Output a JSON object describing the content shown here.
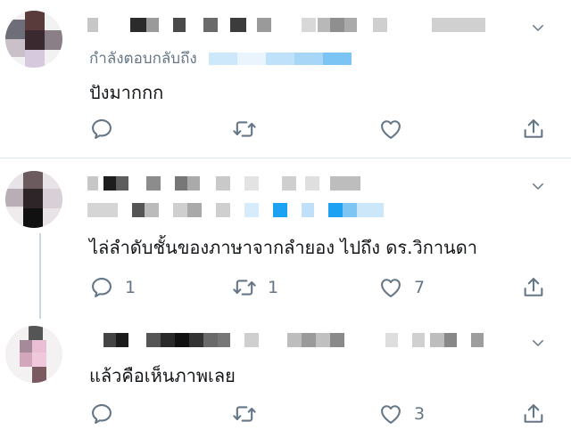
{
  "tweets": [
    {
      "reply_to_prefix": "กำลังตอบกลับถึง",
      "text": "ปังมากกก",
      "replies": "",
      "retweets": "",
      "likes": ""
    },
    {
      "text": "ไล่ลำดับชั้นของภาษาจากลำยอง ไปถึง ดร.วิกานดา",
      "replies": "1",
      "retweets": "1",
      "likes": "7"
    },
    {
      "text": "แล้วคือเห็นภาพเลย",
      "replies": "",
      "retweets": "",
      "likes": "3"
    }
  ],
  "colors": {
    "icon_gray": "#657786",
    "divider": "#e1e8ed",
    "link_blue": "#1da1f2"
  },
  "icons": {
    "reply": "reply-icon",
    "retweet": "retweet-icon",
    "like": "heart-icon",
    "share": "share-icon",
    "more": "chevron-down-icon"
  }
}
